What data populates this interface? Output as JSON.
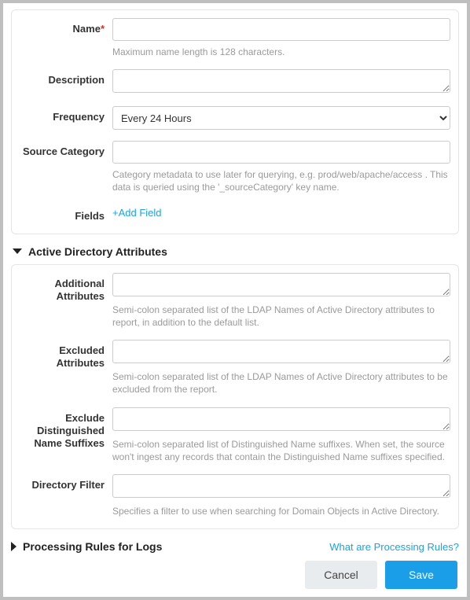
{
  "main": {
    "name": {
      "label": "Name",
      "value": "",
      "helper": "Maximum name length is 128 characters."
    },
    "description": {
      "label": "Description",
      "value": ""
    },
    "frequency": {
      "label": "Frequency",
      "selected": "Every 24 Hours"
    },
    "sourceCategory": {
      "label": "Source Category",
      "value": "",
      "helper": "Category metadata to use later for querying, e.g. prod/web/apache/access . This data is queried using the '_sourceCategory' key name."
    },
    "fields": {
      "label": "Fields",
      "addLink": "+Add Field"
    }
  },
  "adSection": {
    "title": "Active Directory Attributes",
    "additionalAttributes": {
      "label": "Additional Attributes",
      "value": "",
      "helper": "Semi-colon separated list of the LDAP Names of Active Directory attributes to report, in addition to the default list."
    },
    "excludedAttributes": {
      "label": "Excluded Attributes",
      "value": "",
      "helper": "Semi-colon separated list of the LDAP Names of Active Directory attributes to be excluded from the report."
    },
    "excludeDistinguishedNameSuffixes": {
      "label": "Exclude Distinguished Name Suffixes",
      "value": "",
      "helper": "Semi-colon separated list of Distinguished Name suffixes. When set, the source won't ingest any records that contain the Distinguished Name suffixes specified."
    },
    "directoryFilter": {
      "label": "Directory Filter",
      "value": "",
      "helper": "Specifies a filter to use when searching for Domain Objects in Active Directory."
    }
  },
  "processingRules": {
    "title": "Processing Rules for Logs",
    "helpLink": "What are Processing Rules?"
  },
  "buttons": {
    "cancel": "Cancel",
    "save": "Save"
  }
}
